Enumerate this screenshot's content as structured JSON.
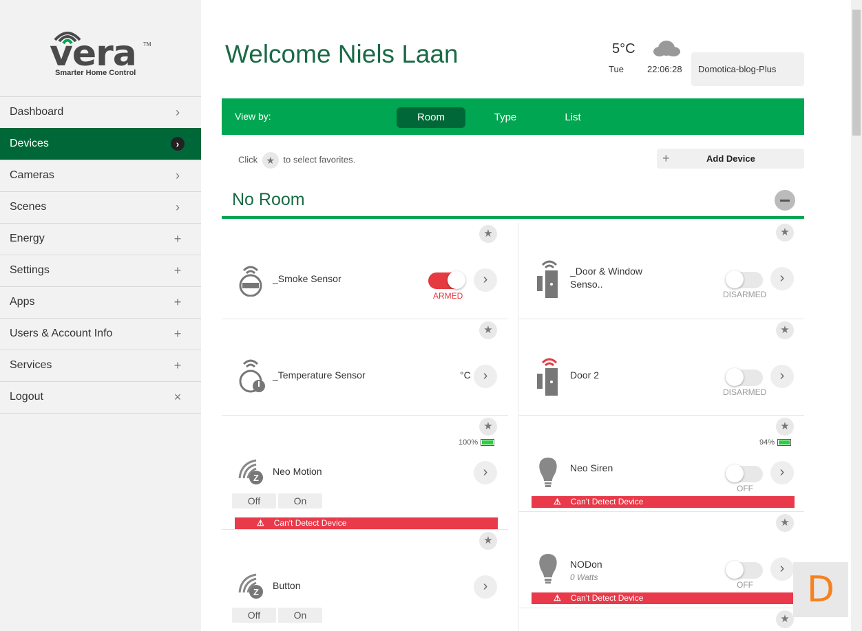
{
  "brand": {
    "name": "vera",
    "tm": "TM",
    "tagline": "Smarter Home Control"
  },
  "sidebar": {
    "items": [
      {
        "label": "Dashboard",
        "indicator": "›"
      },
      {
        "label": "Devices",
        "indicator": "›"
      },
      {
        "label": "Cameras",
        "indicator": "›"
      },
      {
        "label": "Scenes",
        "indicator": "›"
      },
      {
        "label": "Energy",
        "indicator": "+"
      },
      {
        "label": "Settings",
        "indicator": "+"
      },
      {
        "label": "Apps",
        "indicator": "+"
      },
      {
        "label": "Users & Account Info",
        "indicator": "+"
      },
      {
        "label": "Services",
        "indicator": "+"
      },
      {
        "label": "Logout",
        "indicator": "×"
      }
    ]
  },
  "header": {
    "welcome": "Welcome Niels Laan",
    "temperature": "5°C",
    "day": "Tue",
    "time": "22:06:28",
    "controller": "Domotica-blog-Plus"
  },
  "viewbar": {
    "label": "View by:",
    "tabs": [
      "Room",
      "Type",
      "List"
    ],
    "active": "Room"
  },
  "toolbar": {
    "hint_before": "Click",
    "hint_after": "to select favorites.",
    "add_device": "Add Device"
  },
  "room": {
    "title": "No Room"
  },
  "devices": {
    "smoke": {
      "name": "_Smoke Sensor",
      "state": "ARMED"
    },
    "door_window": {
      "name": "_Door & Window",
      "name2": "Senso..",
      "state": "DISARMED"
    },
    "temperature": {
      "name": "_Temperature Sensor",
      "unit": "°C"
    },
    "door2": {
      "name": "Door 2",
      "state": "DISARMED"
    },
    "neo_motion": {
      "name": "Neo Motion",
      "battery": "100%",
      "off": "Off",
      "on": "On",
      "alert": "Can't Detect Device"
    },
    "neo_siren": {
      "name": "Neo Siren",
      "battery": "94%",
      "state": "OFF",
      "alert": "Can't Detect Device"
    },
    "button": {
      "name": "Button",
      "off": "Off",
      "on": "On"
    },
    "nodon": {
      "name": "NODon",
      "power": "0 Watts",
      "state": "OFF",
      "alert": "Can't Detect Device"
    }
  },
  "badge": {
    "letter": "D"
  },
  "colors": {
    "accent": "#00a651",
    "dark_accent": "#006838",
    "alert": "#e83a4a",
    "badge": "#f58220"
  }
}
